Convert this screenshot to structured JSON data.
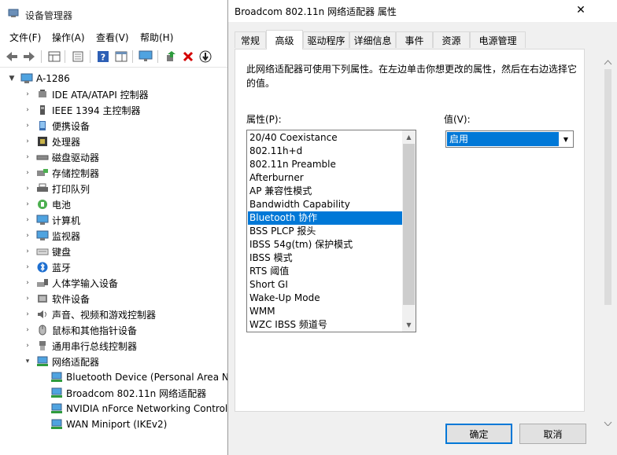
{
  "device_manager": {
    "title": "设备管理器",
    "menu": [
      "文件(F)",
      "操作(A)",
      "查看(V)",
      "帮助(H)"
    ],
    "toolbar_icons": [
      "back-icon",
      "forward-icon",
      "properties-grid-icon",
      "console-tree-icon",
      "help-icon",
      "action-pane-icon",
      "monitor-icon",
      "update-driver-icon",
      "uninstall-icon",
      "download-icon"
    ],
    "tree": {
      "root": "A-1286",
      "categories": [
        {
          "label": "IDE ATA/ATAPI 控制器",
          "icon": "ide-icon"
        },
        {
          "label": "IEEE 1394 主控制器",
          "icon": "ieee1394-icon"
        },
        {
          "label": "便携设备",
          "icon": "portable-device-icon"
        },
        {
          "label": "处理器",
          "icon": "processor-icon"
        },
        {
          "label": "磁盘驱动器",
          "icon": "disk-drive-icon"
        },
        {
          "label": "存储控制器",
          "icon": "storage-controller-icon"
        },
        {
          "label": "打印队列",
          "icon": "print-queue-icon"
        },
        {
          "label": "电池",
          "icon": "battery-icon"
        },
        {
          "label": "计算机",
          "icon": "computer-icon"
        },
        {
          "label": "监视器",
          "icon": "monitor-icon"
        },
        {
          "label": "键盘",
          "icon": "keyboard-icon"
        },
        {
          "label": "蓝牙",
          "icon": "bluetooth-icon"
        },
        {
          "label": "人体学输入设备",
          "icon": "hid-icon"
        },
        {
          "label": "软件设备",
          "icon": "software-device-icon"
        },
        {
          "label": "声音、视频和游戏控制器",
          "icon": "sound-icon"
        },
        {
          "label": "鼠标和其他指针设备",
          "icon": "mouse-icon"
        },
        {
          "label": "通用串行总线控制器",
          "icon": "usb-icon"
        },
        {
          "label": "网络适配器",
          "icon": "network-adapter-icon",
          "expanded": true
        }
      ],
      "network_children": [
        "Bluetooth Device (Personal Area Ne",
        "Broadcom 802.11n 网络适配器",
        "NVIDIA nForce Networking Controlle",
        "WAN Miniport (IKEv2)"
      ]
    }
  },
  "dialog": {
    "title": "Broadcom 802.11n 网络适配器 属性",
    "close_glyph": "✕",
    "tabs": [
      "常规",
      "高级",
      "驱动程序",
      "详细信息",
      "事件",
      "资源",
      "电源管理"
    ],
    "active_tab": "高级",
    "description": "此网络适配器可使用下列属性。在左边单击你想更改的属性，然后在右边选择它的值。",
    "property_label": "属性(P):",
    "value_label": "值(V):",
    "properties": [
      "20/40 Coexistance",
      "802.11h+d",
      "802.11n Preamble",
      "Afterburner",
      "AP 兼容性模式",
      "Bandwidth Capability",
      "Bluetooth 协作",
      "BSS PLCP 报头",
      "IBSS 54g(tm) 保护模式",
      "IBSS 模式",
      "RTS 阈值",
      "Short GI",
      "Wake-Up Mode",
      "WMM",
      "WZC IBSS 频道号"
    ],
    "selected_property": "Bluetooth 协作",
    "value": "启用",
    "ok_label": "确定",
    "cancel_label": "取消"
  },
  "colors": {
    "selection": "#0078d7",
    "dialog_bg": "#f0f0f0"
  }
}
